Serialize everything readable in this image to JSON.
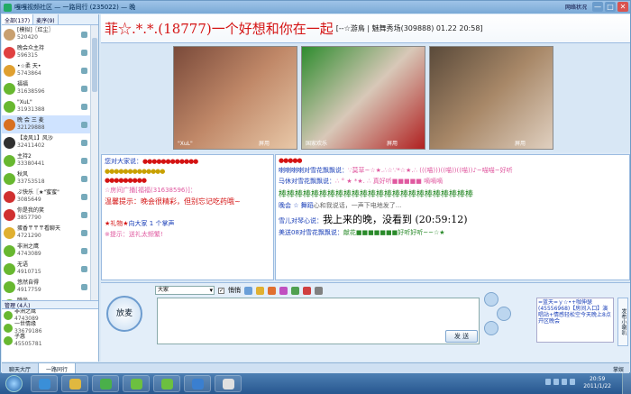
{
  "window": {
    "title": "嘎嘎视频社区 — 一路同行 (235022) — 晚",
    "network_status": "网络状况",
    "min": "—",
    "max": "□",
    "close": "✕"
  },
  "left_panel": {
    "tabs": [
      "全部(137)",
      "麦序(9)"
    ],
    "users": [
      {
        "name": "[模拟]〖红尘〗",
        "id": "520420",
        "color": "#c8a070"
      },
      {
        "name": "晚会众主持",
        "id": "596315",
        "color": "#e04040"
      },
      {
        "name": "•☆柔 天•",
        "id": "5743864",
        "color": "#e0a030"
      },
      {
        "name": "福福",
        "id": "31638596",
        "color": "#68b830"
      },
      {
        "name": "\"XuL\"",
        "id": "31931388",
        "color": "#68b830"
      },
      {
        "name": "晚 会 三 麦",
        "id": "32129888",
        "color": "#d87020",
        "selected": true
      },
      {
        "name": "【凌风1】风沙",
        "id": "32411402",
        "color": "#303030"
      },
      {
        "name": "主持2",
        "id": "33380441",
        "color": "#68b830"
      },
      {
        "name": "秋风",
        "id": "33753518",
        "color": "#68b830"
      },
      {
        "name": "ぷ快乐〖★\"蜜蜜\"",
        "id": "3085649",
        "color": "#d03030"
      },
      {
        "name": "你是我的笑",
        "id": "3857790",
        "color": "#d03030"
      },
      {
        "name": "蛋香〒〒〒看聊天",
        "id": "4721290",
        "color": "#e0b030"
      },
      {
        "name": "非洲之鹰",
        "id": "4743089",
        "color": "#68b830"
      },
      {
        "name": "无语",
        "id": "4910715",
        "color": "#68b830"
      },
      {
        "name": "悠然自得",
        "id": "4917759",
        "color": "#68b830"
      },
      {
        "name": "時尚",
        "id": "5627224",
        "color": "#68b830"
      }
    ],
    "admin_header": "管理 (4人)",
    "admins": [
      {
        "name": "非洲之鹰",
        "id": "4743089",
        "color": "#68b830"
      },
      {
        "name": "一世情缘",
        "id": "33679186",
        "color": "#68b830"
      },
      {
        "name": "子惠",
        "id": "45505781",
        "color": "#68b830"
      }
    ]
  },
  "room": {
    "title_main": "菲☆.*.*.(18777)一个好想和你在一起",
    "title_sub": "[--☆游鳥 | 魅舞秀场(309888) 01.22 20:58]"
  },
  "videos": [
    {
      "label": "\"XuL\"",
      "label2": "屏用",
      "colors": [
        "#7a4a3a",
        "#c08868",
        "#e8c8a8"
      ]
    },
    {
      "label": "国家欢乐",
      "label2": "屏用",
      "colors": [
        "#2e8c2e",
        "#d8c8b8",
        "#b02020"
      ]
    },
    {
      "label": "",
      "label2": "屏用",
      "colors": [
        "#5a4a3a",
        "#a88868",
        "#e0d0c0"
      ]
    }
  ],
  "public_chat": {
    "lines": [
      {
        "who": "您对大家说：",
        "text": "●●●●●●●●●●●●"
      },
      {
        "who": "",
        "text": "●●●●●●●●●●●●●"
      },
      {
        "who": "",
        "text": "●●●●●●●●●"
      },
      {
        "who": "☆房间广播[福福(31638596)]：",
        "text": ""
      },
      {
        "who": "",
        "text": "温馨提示：晚会很精彩，但别忘记吃药哦~"
      },
      {
        "who": "★礼物★",
        "text": "向大家 1 个掌声"
      },
      {
        "who": "",
        "text": "※提示：送礼太频繁!"
      }
    ]
  },
  "private_chat": {
    "lines": [
      {
        "who": "",
        "text": "●●●●●"
      },
      {
        "who": "喇喇喇喇对雪花飘飘说：",
        "text": "∵莫草~☆★.∴☆∵*☆★.∴ (((喵)))((喵))((喵))♪~喵喵~好听"
      },
      {
        "who": "马休对雪花飘飘说：",
        "text": "∴ ° ★ *★. ∴ 真好听■■■■■ 嘀嘀嘀"
      },
      {
        "who": "",
        "text": "棒棒棒棒棒棒棒棒棒棒棒棒棒棒棒棒棒棒棒棒棒棒棒棒"
      },
      {
        "who": "晚会 ☆ 舞蹈",
        "text": "心和我说话，一声下电地发了..."
      },
      {
        "who": "雪儿对琴心说：",
        "text": "我上来的晚，没看到 (20:59:12)"
      },
      {
        "who": "美送08对雪花飘飘说：",
        "text": "献花■■■■■■■好听好听~~☆★"
      }
    ]
  },
  "input": {
    "speak_label": "放麦",
    "target": "大家",
    "private_label": "悄悄",
    "send_label": "发 送",
    "notice": "=蓝天=ｙ☆•+咖伸瑟(45556968)【房间入口】演唱站+情感轻松空今天晚上8点开区晚会",
    "vtab_label": "发布小喇叭"
  },
  "status_tabs": [
    "聊天大厅",
    "一路同行"
  ],
  "status_right": "掌娱",
  "taskbar": {
    "time": "20:59",
    "date": "2011/1/22",
    "buttons": [
      {
        "name": "ie",
        "color": "#3a8fd8"
      },
      {
        "name": "folder",
        "color": "#e0b840"
      },
      {
        "name": "media",
        "color": "#4ab04a"
      },
      {
        "name": "frog1",
        "color": "#6cc040"
      },
      {
        "name": "frog2",
        "color": "#6cc040"
      },
      {
        "name": "qq",
        "color": "#3a7fd0"
      },
      {
        "name": "app",
        "color": "#e0e0e0"
      }
    ]
  }
}
